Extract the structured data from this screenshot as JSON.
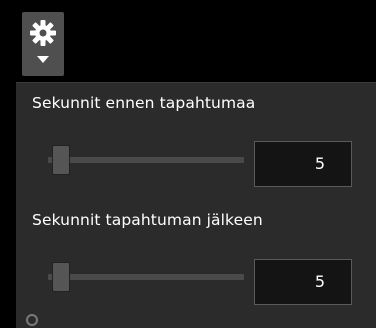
{
  "toolbar": {
    "settings_icon": "gear-icon",
    "dropdown_icon": "caret-down-icon"
  },
  "settings": {
    "before_event": {
      "label": "Sekunnit ennen tapahtumaa",
      "value": "5",
      "slider_fraction": 0.02
    },
    "after_event": {
      "label": "Sekunnit tapahtuman jälkeen",
      "value": "5",
      "slider_fraction": 0.02
    }
  },
  "colors": {
    "background": "#000000",
    "panel": "#2b2b2b",
    "button": "#4f4f4f",
    "text": "#ffffff"
  }
}
